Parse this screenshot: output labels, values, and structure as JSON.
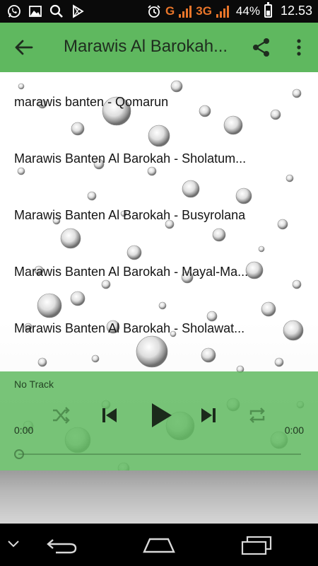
{
  "status_bar": {
    "network_label": "G",
    "network_label_2": "3G",
    "battery": "44%",
    "time": "12.53",
    "icons": [
      "whatsapp-icon",
      "image-icon",
      "search-icon",
      "play-store-icon",
      "alarm-icon",
      "battery-icon"
    ]
  },
  "app_bar": {
    "title": "Marawis Al Barokah...",
    "color": "#5fb85f"
  },
  "tracks": [
    {
      "label": "marawis banten - Qomarun"
    },
    {
      "label": "Marawis Banten Al Barokah -  Sholatum..."
    },
    {
      "label": "Marawis Banten Al Barokah - Busyrolana"
    },
    {
      "label": "Marawis Banten Al Barokah - Mayal-Ma..."
    },
    {
      "label": "Marawis Banten Al Barokah - Sholawat..."
    }
  ],
  "player": {
    "now_playing": "No Track",
    "elapsed": "0:00",
    "duration": "0:00",
    "progress": 0,
    "icons": [
      "shuffle-icon",
      "previous-icon",
      "play-icon",
      "next-icon",
      "repeat-icon"
    ]
  },
  "nav_bar": {
    "icons": [
      "hide-keyboard-icon",
      "back-icon",
      "home-icon",
      "recents-icon"
    ]
  }
}
